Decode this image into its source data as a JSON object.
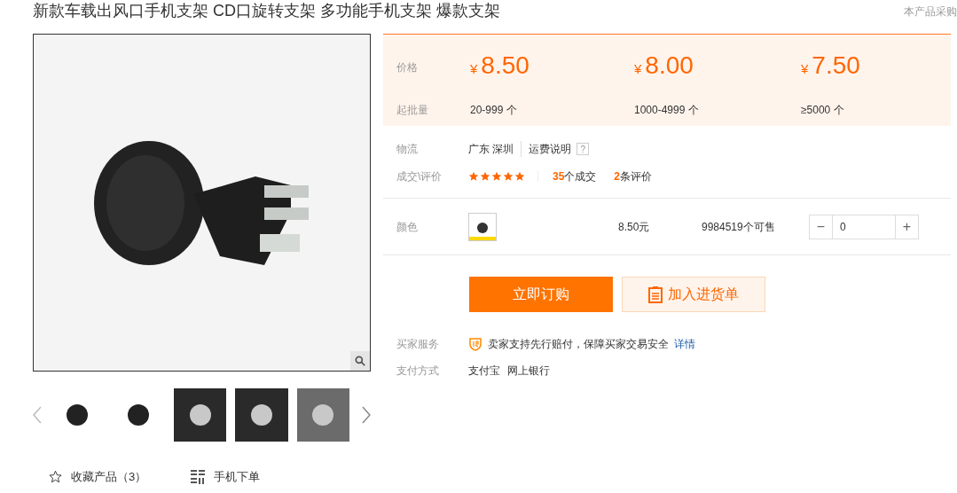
{
  "title": "新款车载出风口手机支架 CD口旋转支架 多功能手机支架 爆款支架",
  "corner_text": "本产品采购",
  "gallery": {
    "thumbnails": [
      {
        "kind": "white",
        "selected": false
      },
      {
        "kind": "white",
        "selected": false
      },
      {
        "kind": "dark",
        "selected": false
      },
      {
        "kind": "dark",
        "selected": false
      },
      {
        "kind": "gray",
        "selected": false
      }
    ]
  },
  "actions": [
    {
      "kind": "star",
      "label": "收藏产品（3）"
    },
    {
      "kind": "qr",
      "label": "手机下单"
    }
  ],
  "price_panel": {
    "price_label": "价格",
    "quantity_label": "起批量",
    "tiers": [
      {
        "currency": "¥",
        "price": "8.50",
        "range": "20-999 个"
      },
      {
        "currency": "¥",
        "price": "8.00",
        "range": "1000-4999 个"
      },
      {
        "currency": "¥",
        "price": "7.50",
        "range": "≥5000 个"
      }
    ]
  },
  "logistics": {
    "label": "物流",
    "location": "广东 深圳",
    "link": "运费说明",
    "help": "?"
  },
  "deals": {
    "label": "成交\\评价",
    "stars": 5,
    "deal_count": "35",
    "deal_text": "个成交",
    "review_count": "2",
    "review_text": "条评价"
  },
  "color_row": {
    "label": "颜色",
    "price": "8.50元",
    "stock": "9984519个可售",
    "minus": "−",
    "quantity": "0",
    "plus": "+"
  },
  "buttons": {
    "buy": "立即订购",
    "cart": "加入进货单"
  },
  "service": {
    "label": "买家服务",
    "text": "卖家支持先行赔付，保障买家交易安全",
    "link": "详情"
  },
  "payment": {
    "label": "支付方式",
    "methods": [
      "支付宝",
      "网上银行"
    ]
  }
}
